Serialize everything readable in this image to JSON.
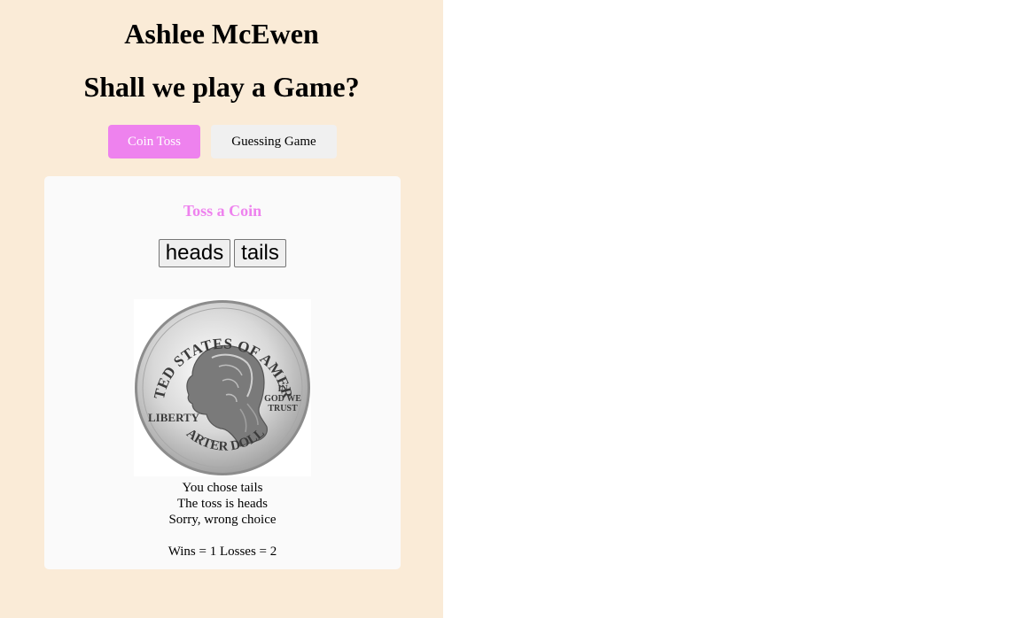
{
  "header": {
    "name": "Ashlee McEwen",
    "prompt": "Shall we play a Game?"
  },
  "tabs": [
    {
      "label": "Coin Toss",
      "active": true
    },
    {
      "label": "Guessing Game",
      "active": false
    }
  ],
  "coin_toss": {
    "title": "Toss a Coin",
    "heads_label": "heads",
    "tails_label": "tails",
    "coin_icon": "quarter-coin-heads-image",
    "coin_text": {
      "top": "UNITED STATES OF AMERICA",
      "left": "LIBERTY",
      "right_1": "IN",
      "right_2": "GOD WE",
      "right_3": "TRUST",
      "bottom": "QUARTER DOLLAR"
    },
    "result": {
      "choice_text": "You chose tails",
      "toss_text": "The toss is heads",
      "outcome_text": "Sorry, wrong choice",
      "score_text": "Wins = 1 Losses = 2"
    }
  },
  "colors": {
    "app_background": "#faebd7",
    "accent": "#ee82ee",
    "card_background": "#fafafa",
    "inactive_tab": "#f0f0f0"
  }
}
